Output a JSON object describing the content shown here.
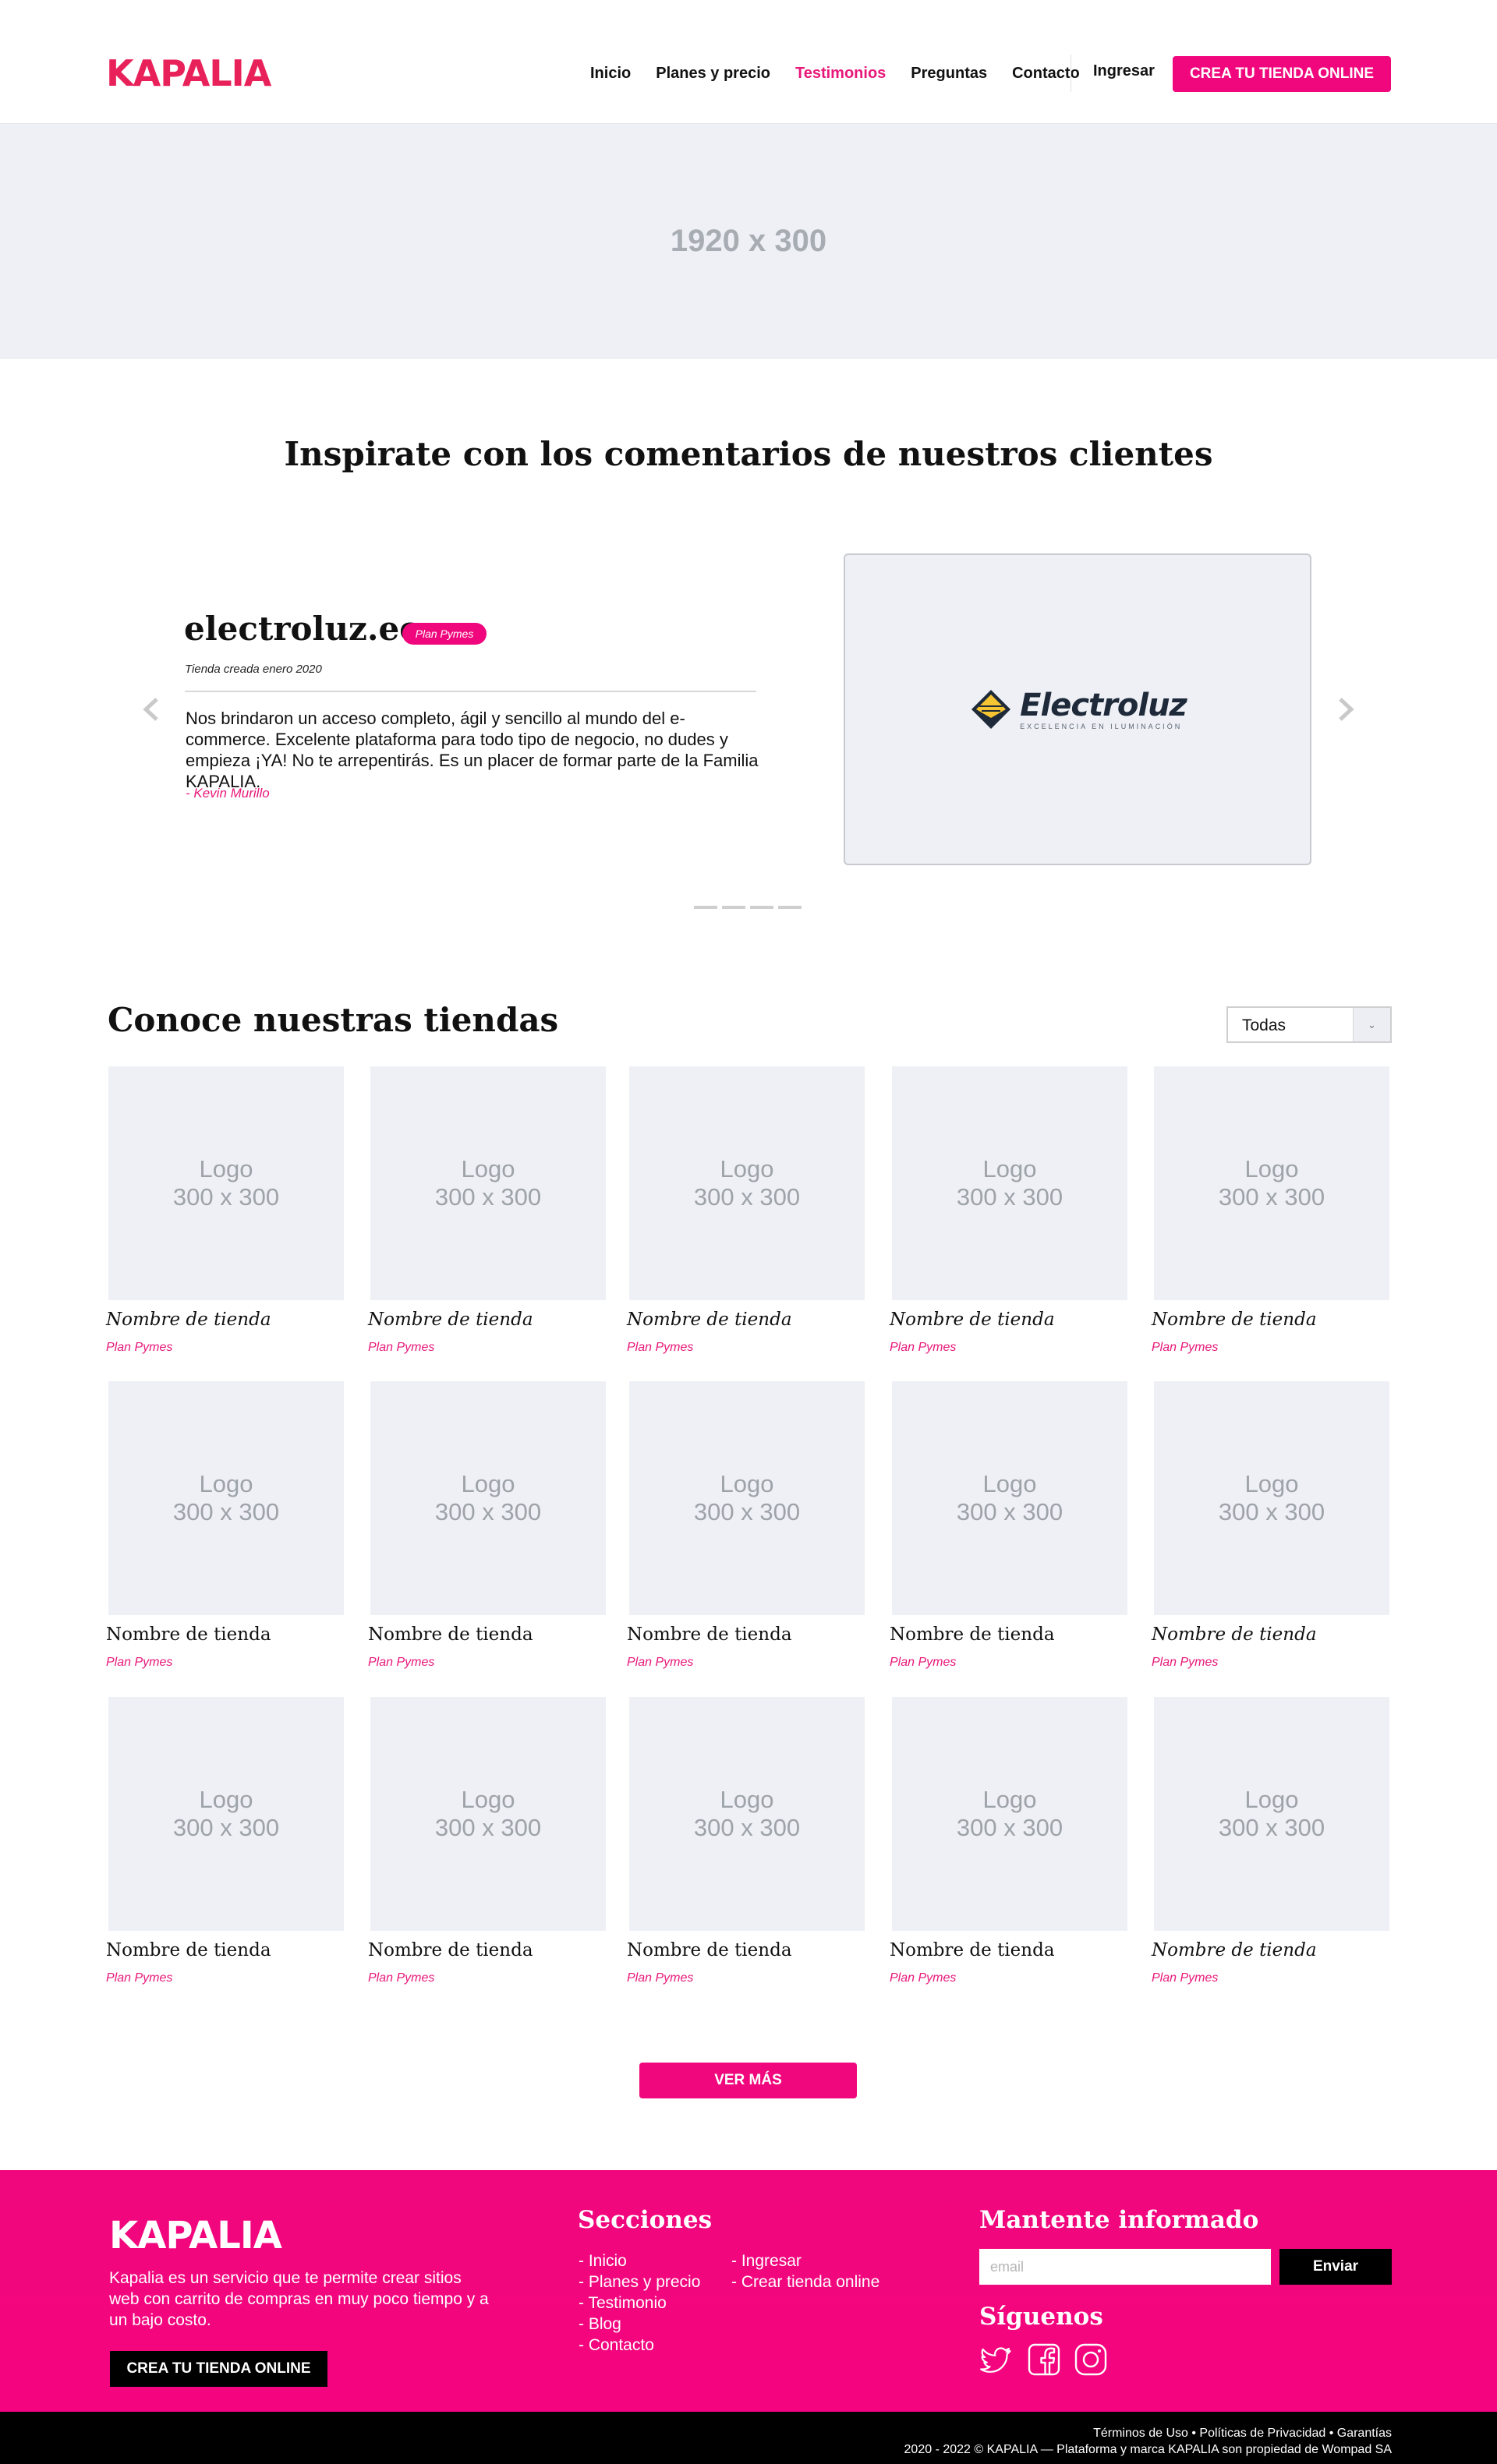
{
  "header": {
    "logo": "KAPALIA",
    "nav": [
      "Inicio",
      "Planes y precio",
      "Testimonios",
      "Preguntas",
      "Contacto"
    ],
    "active_nav": "Testimonios",
    "login": "Ingresar",
    "cta": "CREA TU TIENDA ONLINE"
  },
  "hero": {
    "placeholder": "1920 x 300"
  },
  "testimonials": {
    "title": "Inspirate con los comentarios de nuestros clientes",
    "store": "electroluz.ec",
    "badge": "Plan Pymes",
    "date": "Tienda creada enero 2020",
    "quote": "Nos brindaron un acceso completo, ágil y sencillo al mundo del e-commerce. Excelente plataforma para todo tipo de negocio, no dudes y empieza ¡YA! No te arrepentirás. Es un placer de formar parte de la Familia KAPALIA.",
    "author": "- Kevin Murillo",
    "brand_name_part1": "Electro",
    "brand_name_part2": "luz",
    "brand_tagline": "EXCELENCIA EN ILUMINACIÓN",
    "prev_icon": "chevron-left-icon",
    "next_icon": "chevron-right-icon",
    "dots_count": 4
  },
  "stores": {
    "title": "Conoce nuestras tiendas",
    "filter_value": "Todas",
    "logo_label": "Logo",
    "logo_size": "300 x 300",
    "items": [
      {
        "name": "Nombre de tienda",
        "plan": "Plan Pymes"
      },
      {
        "name": "Nombre de tienda",
        "plan": "Plan Pymes"
      },
      {
        "name": "Nombre de tienda",
        "plan": "Plan Pymes"
      },
      {
        "name": "Nombre de tienda",
        "plan": "Plan Pymes"
      },
      {
        "name": "Nombre de tienda",
        "plan": "Plan Pymes"
      },
      {
        "name": "Nombre de tienda",
        "plan": "Plan Pymes"
      },
      {
        "name": "Nombre de tienda",
        "plan": "Plan Pymes"
      },
      {
        "name": "Nombre de tienda",
        "plan": "Plan Pymes"
      },
      {
        "name": "Nombre de tienda",
        "plan": "Plan Pymes"
      },
      {
        "name": "Nombre de tienda",
        "plan": "Plan Pymes"
      },
      {
        "name": "Nombre de tienda",
        "plan": "Plan Pymes"
      },
      {
        "name": "Nombre de tienda",
        "plan": "Plan Pymes"
      },
      {
        "name": "Nombre de tienda",
        "plan": "Plan Pymes"
      },
      {
        "name": "Nombre de tienda",
        "plan": "Plan Pymes"
      },
      {
        "name": "Nombre de tienda",
        "plan": "Plan Pymes"
      }
    ],
    "more": "VER MÁS"
  },
  "footer": {
    "logo": "KAPALIA",
    "description": "Kapalia es un servicio que te permite crear sitios web con carrito de compras en muy poco tiempo y a un bajo costo.",
    "cta": "CREA TU TIENDA ONLINE",
    "sections_title": "Secciones",
    "sections_col1": [
      "- Inicio",
      "- Planes y precio",
      "- Testimonio",
      "- Blog",
      "- Contacto"
    ],
    "sections_col2": [
      "- Ingresar",
      "- Crear tienda online"
    ],
    "newsletter_title": "Mantente informado",
    "email_placeholder": "email",
    "send": "Enviar",
    "follow_title": "Síguenos",
    "social": [
      "twitter-icon",
      "facebook-icon",
      "instagram-icon"
    ]
  },
  "bottom": {
    "links": "Términos de Uso • Políticas de Privacidad • Garantías",
    "copyright": "2020 - 2022 © KAPALIA — Plataforma y marca KAPALIA son propiedad de Wompad SA"
  },
  "colors": {
    "accent": "#f0077d",
    "logo_red": "#e8215a",
    "placeholder_bg": "#eef0f5",
    "footer_bar": "#000000"
  }
}
